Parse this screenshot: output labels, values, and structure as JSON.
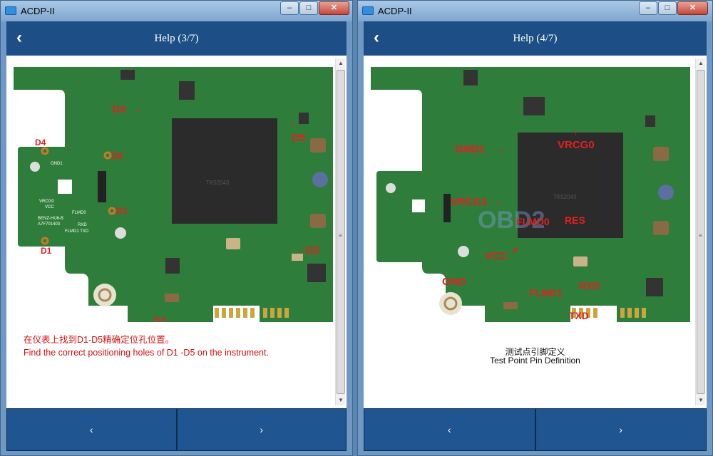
{
  "left": {
    "app_title": "ACDP-II",
    "header_title": "Help (3/7)",
    "back_glyph": "‹",
    "caption_cn": "在仪表上找到D1-D5精确定位孔位置。",
    "caption_en": "Find the correct positioning holes of D1 -D5 on the instrument.",
    "board_labels": {
      "d4": "D4",
      "d5": "D5",
      "d2": "D2",
      "d1": "D1"
    },
    "inset_labels": {
      "d4": "D4",
      "d5": "D5",
      "d2": "D2",
      "d1": "D1"
    },
    "chip_print": "TK52043",
    "silk": {
      "vrcg": "VRCG0",
      "gnd": "GND1",
      "vcc": "VCC",
      "flmd": "FLMD0",
      "rxd": "RXD",
      "flmd1": "FLMD1 TXD",
      "part": "BENZ-HU6-B",
      "serial": "A7F701403"
    },
    "footer_prev": "‹",
    "footer_next": "›"
  },
  "right": {
    "app_title": "ACDP-II",
    "header_title": "Help (4/7)",
    "back_glyph": "‹",
    "caption_cn": "测试点引脚定义",
    "caption_en": "Test Point Pin Definition",
    "pin_labels": {
      "gnd1": "GND1",
      "vrcg0": "VRCG0",
      "vrcg1": "VRCG1",
      "flmd0": "FLMD0",
      "res": "RES",
      "vcc": "VCC",
      "gnd": "GND",
      "flmd1": "FLMD1",
      "rxd": "RXD",
      "txd": "TXD"
    },
    "watermark": "OBD2",
    "chip_print": "TK52043",
    "footer_prev": "‹",
    "footer_next": "›"
  },
  "window_controls": {
    "minimize": "–",
    "maximize": "□",
    "close": "✕"
  },
  "colors": {
    "header": "#1d4f86",
    "pcb": "#2e7d3a",
    "label_red": "#e32020",
    "titlebar": "#a9c8e6"
  }
}
